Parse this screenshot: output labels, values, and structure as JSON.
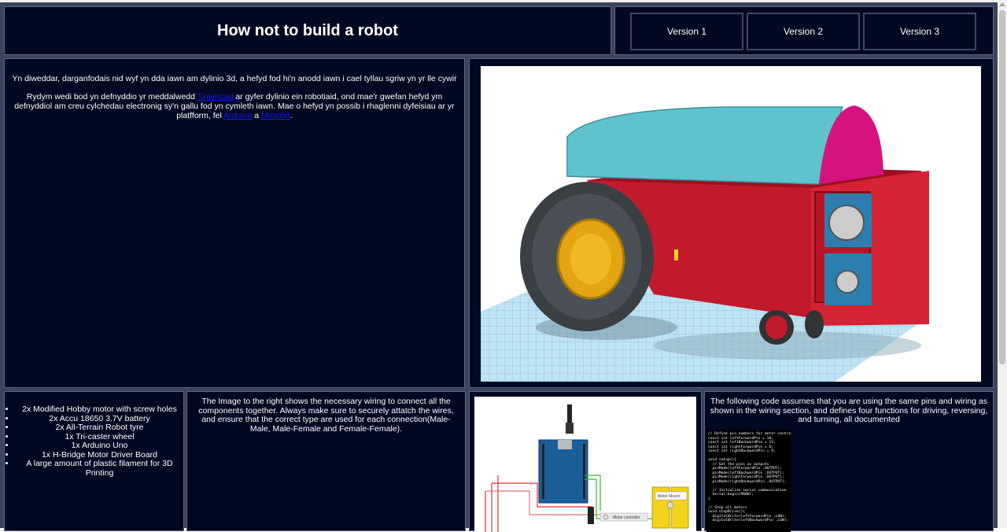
{
  "header": {
    "title": "How not to build a robot"
  },
  "nav": {
    "version1": "Version 1",
    "version2": "Version 2",
    "version3": "Version 3"
  },
  "intro": {
    "p1": "Yn diweddar, darganfodais nid wyf yn dda iawn am dylinio 3d, a hefyd fod hi'n anodd iawn i cael tyllau sgriw yn yr lle cywir",
    "p2_a": "Rydym wedi bod yn defnyddio yr meddalwedd ",
    "p2_link_tinkercad": "Tinkercad",
    "p2_b": " ar gyfer dylinio ein robotiaid, ond mae'r gwefan hefyd ym defnyddiol am creu cylchedau electronig sy'n gallu fod yn cymleth iawn. Mae o hefyd yn possib i rhaglenni dyfeisiau ar yr platfform, fel ",
    "p2_link_arduino": "Arduino",
    "p2_c": " a ",
    "p2_link_microbit": "Microbit",
    "p2_d": "."
  },
  "parts": [
    "2x Modified Hobby motor with screw holes",
    "2x Accu 18650 3.7V battery",
    "2x All-Terrain Robot tyre",
    "1x Tri-caster wheel",
    "1x Arduino Uno",
    "1x H-Bridge Motor Driver Board",
    "A large amount of plastic filament for 3D Printing"
  ],
  "wiring": {
    "text": "The Image to the right shows the necessary wiring to connect all the components together. Always make sure to securely attatch the wires, and ensure that the correct type are used for each connection(Male-Male, Male-Female and Female-Female).",
    "label_motor_controller": "Motor controller",
    "label_motor_mount": "Motor Mount"
  },
  "code": {
    "intro": "The following code assumes that you are using the same pins and wiring as shown in the wiring section, and defines four functions for driving, reversing, and turning, all documented",
    "listing": "// Define pin numbers for motor control\nconst int leftForwardPin = 10;\nconst int leftBackwardPin = 11;\nconst int rightForwardPin = 6;\nconst int rightBackwardPin = 9;\n\nvoid setup(){\n  // Set the pins as outputs\n  pinMode(leftForwardPin ,OUTPUT);\n  pinMode(leftBackwardPin ,OUTPUT);\n  pinMode(rightForwardPin ,OUTPUT);\n  pinMode(rightBackwardPin ,OUTPUT);\n\n  // Initialize serial communication\n  Serial.begin(9600);\n}\n\n// Stop all motors\nvoid stopDrive(){\n  digitalWrite(leftForwardPin ,LOW);\n  digitalWrite(leftBackwardPin ,LOW);"
  }
}
